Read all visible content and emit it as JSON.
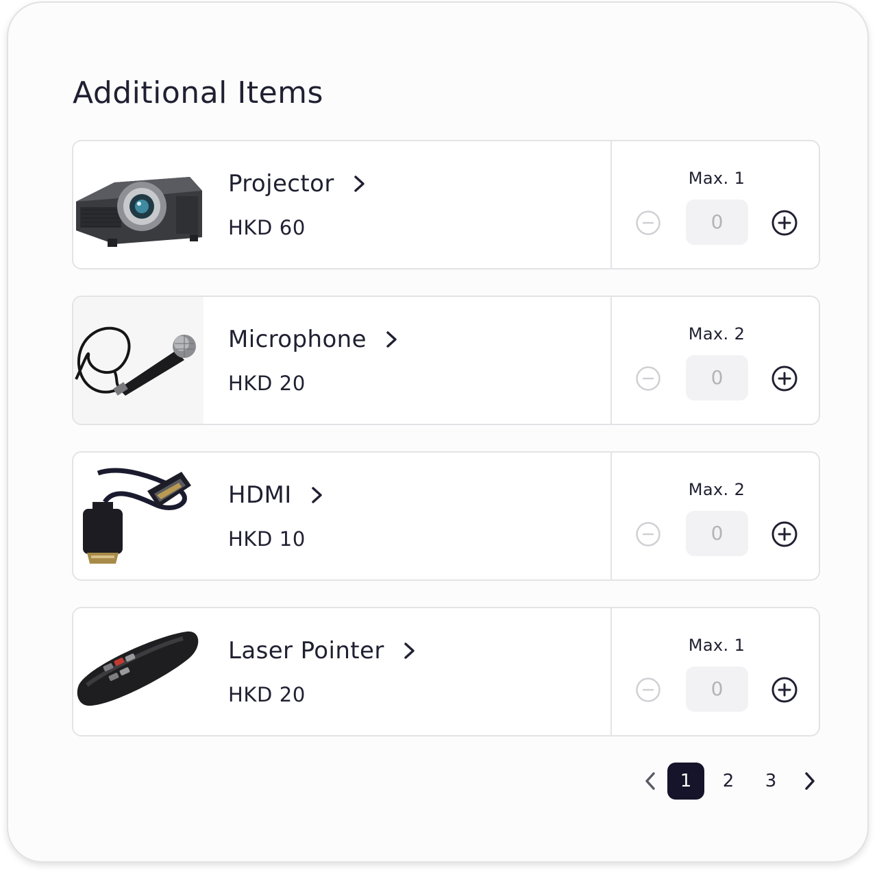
{
  "page": {
    "title": "Additional Items"
  },
  "items": [
    {
      "name": "Projector",
      "price": "HKD 60",
      "max_label": "Max. 1",
      "quantity": "0",
      "image": "projector"
    },
    {
      "name": "Microphone",
      "price": "HKD 20",
      "max_label": "Max. 2",
      "quantity": "0",
      "image": "microphone"
    },
    {
      "name": "HDMI",
      "price": "HKD 10",
      "max_label": "Max. 2",
      "quantity": "0",
      "image": "hdmi-cable"
    },
    {
      "name": "Laser Pointer",
      "price": "HKD 20",
      "max_label": "Max. 1",
      "quantity": "0",
      "image": "laser-pointer"
    }
  ],
  "icons": {
    "details": "chevron-right-icon",
    "decrement": "minus-circle-icon",
    "increment": "plus-circle-icon",
    "prev_page": "chevron-left-icon",
    "next_page": "chevron-right-icon"
  },
  "pagination": {
    "pages": [
      "1",
      "2",
      "3"
    ],
    "current": "1"
  },
  "colors": {
    "primary_dark": "#15142a",
    "text": "#202032",
    "border": "#e3e3e6",
    "disabled": "#d0d0d4",
    "qty_bg": "#f2f2f4"
  }
}
